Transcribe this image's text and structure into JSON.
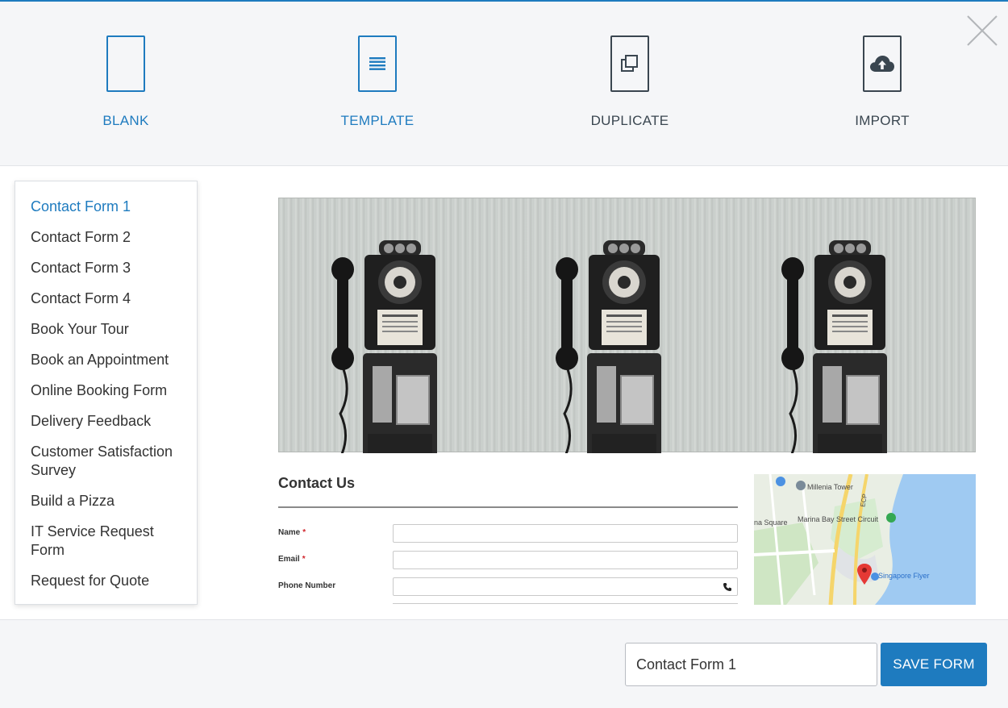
{
  "options": [
    {
      "label": "BLANK",
      "icon": "blank-document-icon"
    },
    {
      "label": "TEMPLATE",
      "icon": "template-document-icon"
    },
    {
      "label": "DUPLICATE",
      "icon": "duplicate-document-icon"
    },
    {
      "label": "IMPORT",
      "icon": "cloud-upload-document-icon"
    }
  ],
  "close_icon": "close-icon",
  "templates": [
    "Contact Form 1",
    "Contact Form 2",
    "Contact Form 3",
    "Contact Form 4",
    "Book Your Tour",
    "Book an Appointment",
    "Online Booking Form",
    "Delivery Feedback",
    "Customer Satisfaction Survey",
    "Build a Pizza",
    "IT Service Request Form",
    "Request for Quote"
  ],
  "selected_template": "Contact Form 1",
  "preview": {
    "title": "Contact Us",
    "fields": [
      {
        "label": "Name",
        "required": true
      },
      {
        "label": "Email",
        "required": true
      },
      {
        "label": "Phone Number",
        "required": false
      }
    ],
    "required_mark": "*",
    "map_labels": {
      "tower": "Millenia Tower",
      "square": "na Square",
      "street": "Marina Bay Street Circuit",
      "flyer": "Singapore Flyer",
      "road": "ECP"
    }
  },
  "footer": {
    "form_name_value": "Contact Form 1",
    "save_label": "SAVE FORM"
  },
  "colors": {
    "accent": "#1e7bbf",
    "icon_dark": "#3a4650",
    "required": "#d0242b"
  }
}
